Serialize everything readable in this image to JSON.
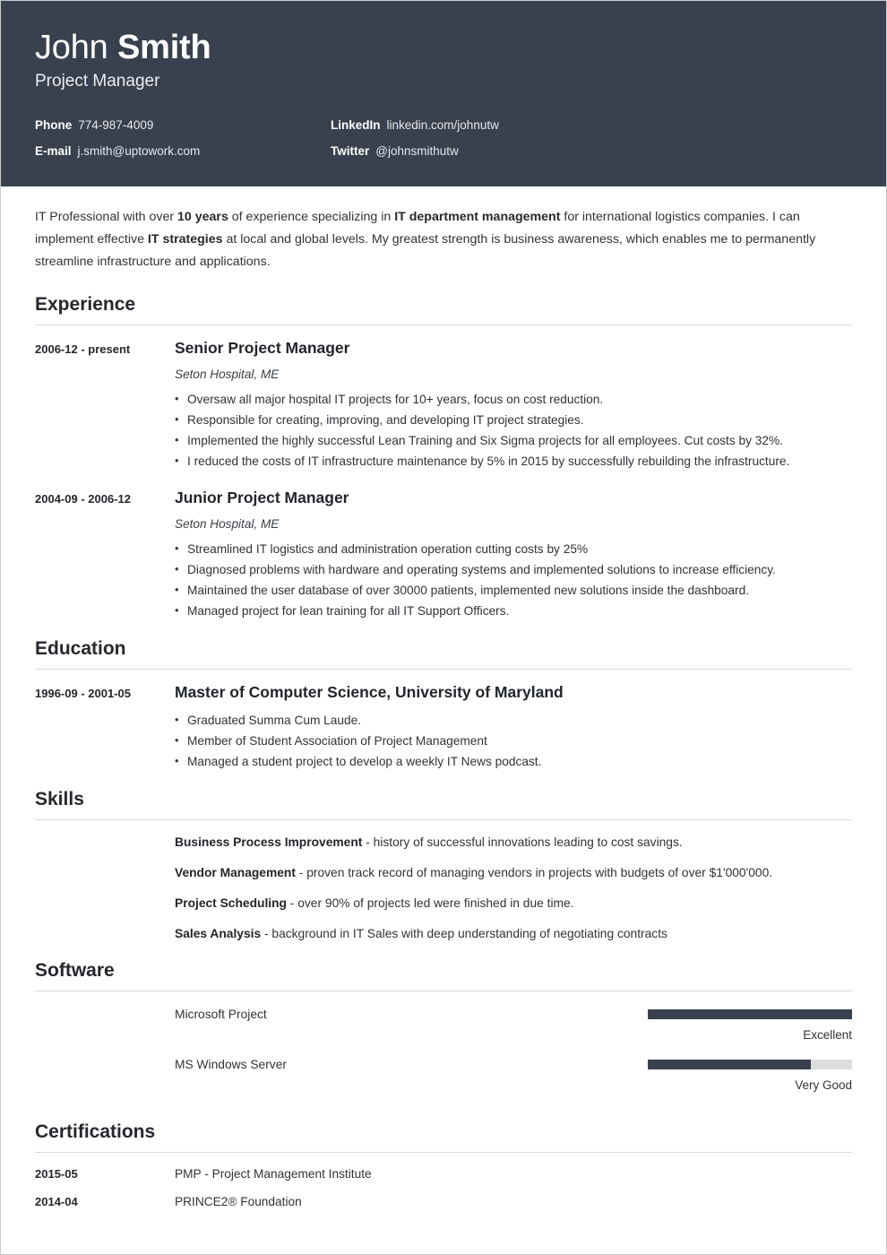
{
  "header": {
    "first_name": "John",
    "last_name": "Smith",
    "job_title": "Project Manager",
    "contacts": [
      {
        "key": "Phone",
        "value": "774-987-4009"
      },
      {
        "key": "LinkedIn",
        "value": "linkedin.com/johnutw"
      },
      {
        "key": "E-mail",
        "value": "j.smith@uptowork.com"
      },
      {
        "key": "Twitter",
        "value": "@johnsmithutw"
      }
    ],
    "background_color": "#39404e",
    "text_color": "#ffffff"
  },
  "summary": {
    "part1": "IT Professional with over ",
    "bold1": "10 years",
    "part2": " of experience specializing in ",
    "bold2": "IT department management",
    "part3": " for international logistics companies. I can implement effective ",
    "bold3": "IT strategies",
    "part4": " at local and global levels. My greatest strength is business awareness, which enables me to permanently streamline infrastructure and applications."
  },
  "sections": {
    "experience_title": "Experience",
    "education_title": "Education",
    "skills_title": "Skills",
    "software_title": "Software",
    "certifications_title": "Certifications"
  },
  "experience": [
    {
      "date": "2006-12 - present",
      "role": "Senior Project Manager",
      "org": "Seton Hospital, ME",
      "bullets": [
        "Oversaw all major hospital IT projects for 10+ years, focus on cost reduction.",
        "Responsible for creating, improving, and developing IT project strategies.",
        "Implemented the highly successful Lean Training and Six Sigma projects for all employees. Cut costs by 32%.",
        "I reduced the costs of IT infrastructure maintenance by 5% in 2015 by successfully rebuilding the infrastructure."
      ]
    },
    {
      "date": "2004-09 - 2006-12",
      "role": "Junior Project Manager",
      "org": "Seton Hospital, ME",
      "bullets": [
        "Streamlined IT logistics and administration operation cutting costs by 25%",
        "Diagnosed problems with hardware and operating systems and implemented solutions to increase efficiency.",
        "Maintained the user database of over 30000 patients, implemented new solutions inside the dashboard.",
        "Managed project for lean training for all IT Support Officers."
      ]
    }
  ],
  "education": [
    {
      "date": "1996-09 - 2001-05",
      "degree": "Master of Computer Science, University of Maryland",
      "bullets": [
        "Graduated Summa Cum Laude.",
        "Member of Student Association of Project Management",
        "Managed a student project to develop a weekly IT News podcast."
      ]
    }
  ],
  "skills": [
    {
      "name": "Business Process Improvement",
      "desc": " - history of successful innovations leading to cost savings."
    },
    {
      "name": "Vendor Management",
      "desc": " - proven track record of managing vendors in projects with budgets of over $1'000'000."
    },
    {
      "name": "Project Scheduling",
      "desc": " - over 90% of projects led were finished in due time."
    },
    {
      "name": "Sales Analysis",
      "desc": " - background in IT Sales with deep understanding of negotiating contracts"
    }
  ],
  "software": [
    {
      "name": "Microsoft Project",
      "level_label": "Excellent",
      "level_percent": 100
    },
    {
      "name": "MS Windows Server",
      "level_label": "Very Good",
      "level_percent": 80
    }
  ],
  "certifications": [
    {
      "date": "2015-05",
      "name": "PMP - Project Management Institute"
    },
    {
      "date": "2014-04",
      "name": "PRINCE2® Foundation"
    }
  ]
}
